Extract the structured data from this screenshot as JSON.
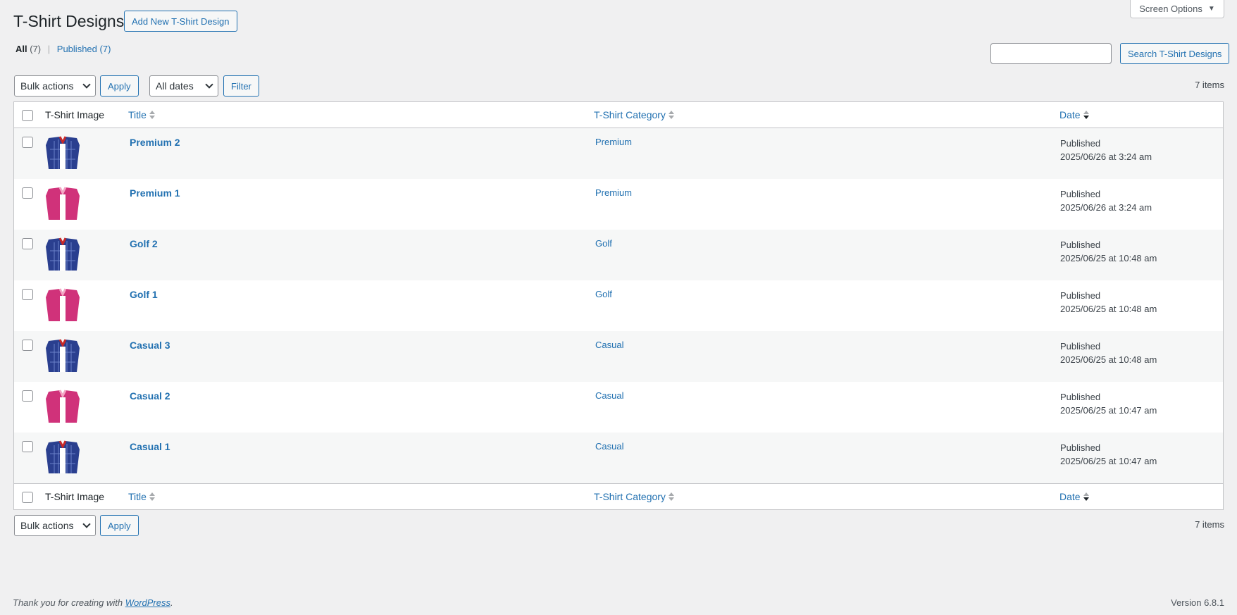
{
  "screen_options": {
    "label": "Screen Options"
  },
  "page": {
    "title": "T-Shirt Designs",
    "add_new_label": "Add New T-Shirt Design"
  },
  "views": {
    "all_label": "All",
    "all_count": "(7)",
    "published_label": "Published",
    "published_count": "(7)",
    "separator": "|"
  },
  "search": {
    "button_label": "Search T-Shirt Designs",
    "placeholder": ""
  },
  "top_nav": {
    "bulk_actions": "Bulk actions",
    "apply_label": "Apply",
    "dates": "All dates",
    "filter_label": "Filter",
    "items_count": "7 items"
  },
  "bottom_nav": {
    "bulk_actions": "Bulk actions",
    "apply_label": "Apply",
    "items_count": "7 items"
  },
  "columns": {
    "image": "T-Shirt Image",
    "title": "Title",
    "category": "T-Shirt Category",
    "date": "Date"
  },
  "colors": {
    "accent": "#2271b1",
    "navy_shirt": "#2a3f8f",
    "pink_shirt": "#d0327a"
  },
  "rows": [
    {
      "title": "Premium 2",
      "category": "Premium",
      "status": "Published",
      "date": "2025/06/26 at 3:24 am",
      "shirt": "navy"
    },
    {
      "title": "Premium 1",
      "category": "Premium",
      "status": "Published",
      "date": "2025/06/26 at 3:24 am",
      "shirt": "pink"
    },
    {
      "title": "Golf 2",
      "category": "Golf",
      "status": "Published",
      "date": "2025/06/25 at 10:48 am",
      "shirt": "navy"
    },
    {
      "title": "Golf 1",
      "category": "Golf",
      "status": "Published",
      "date": "2025/06/25 at 10:48 am",
      "shirt": "pink"
    },
    {
      "title": "Casual 3",
      "category": "Casual",
      "status": "Published",
      "date": "2025/06/25 at 10:48 am",
      "shirt": "navy"
    },
    {
      "title": "Casual 2",
      "category": "Casual",
      "status": "Published",
      "date": "2025/06/25 at 10:47 am",
      "shirt": "pink"
    },
    {
      "title": "Casual 1",
      "category": "Casual",
      "status": "Published",
      "date": "2025/06/25 at 10:47 am",
      "shirt": "navy"
    }
  ],
  "footer": {
    "thanks_prefix": "Thank you for creating with ",
    "wp_link": "WordPress",
    "thanks_suffix": ".",
    "version": "Version 6.8.1"
  }
}
